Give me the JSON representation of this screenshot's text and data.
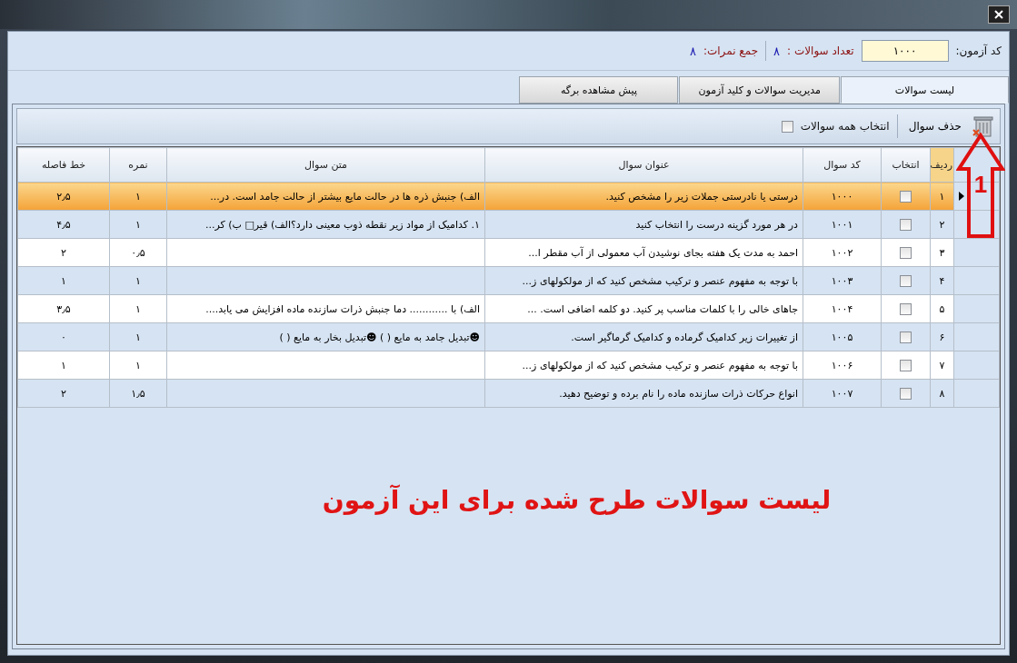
{
  "header": {
    "exam_code_label": "کد آزمون:",
    "exam_code": "۱۰۰۰",
    "question_count_label": "تعداد سوالات :",
    "question_count": "۸",
    "total_score_label": "جمع نمرات:",
    "total_score": "۸"
  },
  "tabs": [
    {
      "label": "لیست سوالات",
      "selected": true
    },
    {
      "label": "مدیریت سوالات و کلید آزمون",
      "selected": false
    },
    {
      "label": "پیش مشاهده برگه",
      "selected": false
    }
  ],
  "toolbar": {
    "delete_label": "حذف سوال",
    "select_all_label": "انتخاب همه سوالات",
    "select_all_checked": false
  },
  "table": {
    "columns": [
      "ردیف",
      "انتخاب",
      "کد سوال",
      "عنوان سوال",
      "متن سوال",
      "نمره",
      "خط فاصله"
    ],
    "rows": [
      {
        "selected": true,
        "row": "۱",
        "checked": false,
        "code": "۱۰۰۰",
        "title": "درستی یا نادرستی جملات زیر را مشخص کنید.",
        "text": "الف) جنبش ذره ها در حالت مایع بیشتر از حالت جامد است.     در...",
        "score": "۱",
        "spacing": "۲٫۵"
      },
      {
        "selected": false,
        "row": "۲",
        "checked": false,
        "code": "۱۰۰۱",
        "title": "در هر مورد گزینه درست را انتخاب کنید",
        "text": "۱. کدامیک از مواد زیر نقطه ذوب معینی دارد؟الف) قیر□    ب) کر...",
        "score": "۱",
        "spacing": "۴٫۵"
      },
      {
        "selected": false,
        "row": "۳",
        "checked": false,
        "code": "۱۰۰۲",
        "title": "احمد به مدت یک هفته بجای نوشیدن آب معمولی از آب مقطر ا...",
        "score": "۰٫۵",
        "spacing": "۲"
      },
      {
        "selected": false,
        "row": "۴",
        "checked": false,
        "code": "۱۰۰۳",
        "title": "با توجه به مفهوم عنصر و ترکیب مشخص کنید که از مولکولهای ز...",
        "score": "۱",
        "spacing": "۱"
      },
      {
        "selected": false,
        "row": "۵",
        "checked": false,
        "code": "۱۰۰۴",
        "title": "جاهای خالی را با کلمات مناسب پر کنید. دو کلمه اضافی است.     ...",
        "text": "الف) با ............ دما جنبش ذرات سازنده ماده افزایش می یابد....",
        "score": "۱",
        "spacing": "۳٫۵"
      },
      {
        "selected": false,
        "row": "۶",
        "checked": false,
        "code": "۱۰۰۵",
        "title": "از تغییرات زیر کدامیک گرماده و کدامیک گرماگیر است.",
        "text": "☻تبدیل جامد به مایع (      )     ☻تبدیل بخار به مایع (      )",
        "score": "۱",
        "spacing": "۰"
      },
      {
        "selected": false,
        "row": "۷",
        "checked": false,
        "code": "۱۰۰۶",
        "title": "با توجه به مفهوم عنصر و ترکیب مشخص کنید که از مولکولهای ز...",
        "score": "۱",
        "spacing": "۱"
      },
      {
        "selected": false,
        "row": "۸",
        "checked": false,
        "code": "۱۰۰۷",
        "title": "انواع حرکات  ذرات سازنده ماده را نام برده و توضیح دهید.",
        "score": "۱٫۵",
        "spacing": "۲"
      }
    ]
  },
  "caption": "لیست سوالات طرح شده برای این آزمون",
  "annotation": {
    "label": "1"
  }
}
